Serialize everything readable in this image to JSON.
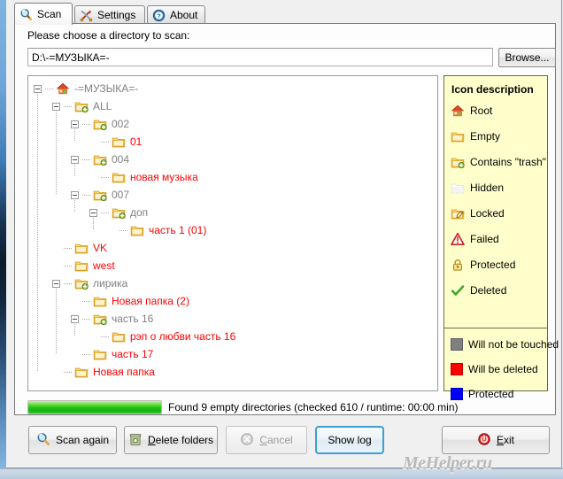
{
  "window": {
    "watermark": "MeHelper.ru"
  },
  "tabs": [
    {
      "label": "Scan",
      "icon": "magnifier-icon",
      "active": true
    },
    {
      "label": "Settings",
      "icon": "tools-icon",
      "active": false
    },
    {
      "label": "About",
      "icon": "question-mark-icon",
      "active": false
    }
  ],
  "scan_page": {
    "prompt_label": "Please choose a directory to scan:",
    "path_value": "D:\\-=МУЗЫКА=-",
    "path_placeholder": "",
    "browse_label": "Browse..."
  },
  "tree": {
    "nodes": [
      {
        "label": "-=МУЗЫКА=-",
        "depth": 0,
        "icon": "home-icon",
        "color": "gray",
        "expander": "minus"
      },
      {
        "label": "ALL",
        "depth": 1,
        "icon": "folder-trash-icon",
        "color": "gray",
        "expander": "minus"
      },
      {
        "label": "002",
        "depth": 2,
        "icon": "folder-trash-icon",
        "color": "gray",
        "expander": "minus"
      },
      {
        "label": "01",
        "depth": 3,
        "icon": "folder-empty-icon",
        "color": "red",
        "expander": "none"
      },
      {
        "label": "004",
        "depth": 2,
        "icon": "folder-trash-icon",
        "color": "gray",
        "expander": "minus"
      },
      {
        "label": "новая музыка",
        "depth": 3,
        "icon": "folder-empty-icon",
        "color": "red",
        "expander": "none"
      },
      {
        "label": "007",
        "depth": 2,
        "icon": "folder-trash-icon",
        "color": "gray",
        "expander": "minus"
      },
      {
        "label": "доп",
        "depth": 3,
        "icon": "folder-trash-icon",
        "color": "gray",
        "expander": "minus"
      },
      {
        "label": "часть 1 (01)",
        "depth": 4,
        "icon": "folder-empty-icon",
        "color": "red",
        "expander": "none"
      },
      {
        "label": "VK",
        "depth": 1,
        "icon": "folder-empty-icon",
        "color": "red",
        "expander": "none"
      },
      {
        "label": "west",
        "depth": 1,
        "icon": "folder-empty-icon",
        "color": "red",
        "expander": "none"
      },
      {
        "label": "лирика",
        "depth": 1,
        "icon": "folder-trash-icon",
        "color": "gray",
        "expander": "minus"
      },
      {
        "label": "Новая папка (2)",
        "depth": 2,
        "icon": "folder-empty-icon",
        "color": "red",
        "expander": "none"
      },
      {
        "label": "часть 16",
        "depth": 2,
        "icon": "folder-trash-icon",
        "color": "gray",
        "expander": "minus"
      },
      {
        "label": "рэп о любви часть 16",
        "depth": 3,
        "icon": "folder-empty-icon",
        "color": "red",
        "expander": "none"
      },
      {
        "label": "часть 17",
        "depth": 2,
        "icon": "folder-empty-icon",
        "color": "red",
        "expander": "none"
      },
      {
        "label": "Новая папка",
        "depth": 1,
        "icon": "folder-empty-icon",
        "color": "red",
        "expander": "none"
      }
    ]
  },
  "legend": {
    "title": "Icon description",
    "icons": [
      {
        "label": "Root",
        "icon": "home-icon"
      },
      {
        "label": "Empty",
        "icon": "folder-empty-icon"
      },
      {
        "label": "Contains \"trash\"",
        "icon": "folder-trash-icon"
      },
      {
        "label": "Hidden",
        "icon": "folder-hidden-icon"
      },
      {
        "label": "Locked",
        "icon": "folder-locked-icon"
      },
      {
        "label": "Failed",
        "icon": "warning-triangle-icon"
      },
      {
        "label": "Protected",
        "icon": "padlock-icon"
      },
      {
        "label": "Deleted",
        "icon": "checkmark-icon"
      }
    ],
    "swatches": [
      {
        "label": "Will not be touched",
        "color": "#808080"
      },
      {
        "label": "Will be deleted",
        "color": "#ff0000"
      },
      {
        "label": "Protected",
        "color": "#0000ff"
      }
    ]
  },
  "status": {
    "progress_percent": 100,
    "text": "Found 9 empty directories (checked 610 / runtime: 00:00 min)"
  },
  "buttons": {
    "scan_again": {
      "label": "Scan again",
      "icon": "magnifier-icon",
      "disabled": false,
      "focused": false
    },
    "delete_folders": {
      "label": "Delete folders",
      "icon": "trashcan-icon",
      "disabled": false,
      "focused": false,
      "accel": "D"
    },
    "cancel": {
      "label": "Cancel",
      "icon": "cancel-icon",
      "disabled": true,
      "focused": false,
      "accel": "C"
    },
    "show_log": {
      "label": "Show log",
      "icon": "",
      "disabled": false,
      "focused": true
    },
    "exit": {
      "label": "Exit",
      "icon": "power-icon",
      "disabled": false,
      "focused": false,
      "accel": "E"
    }
  }
}
